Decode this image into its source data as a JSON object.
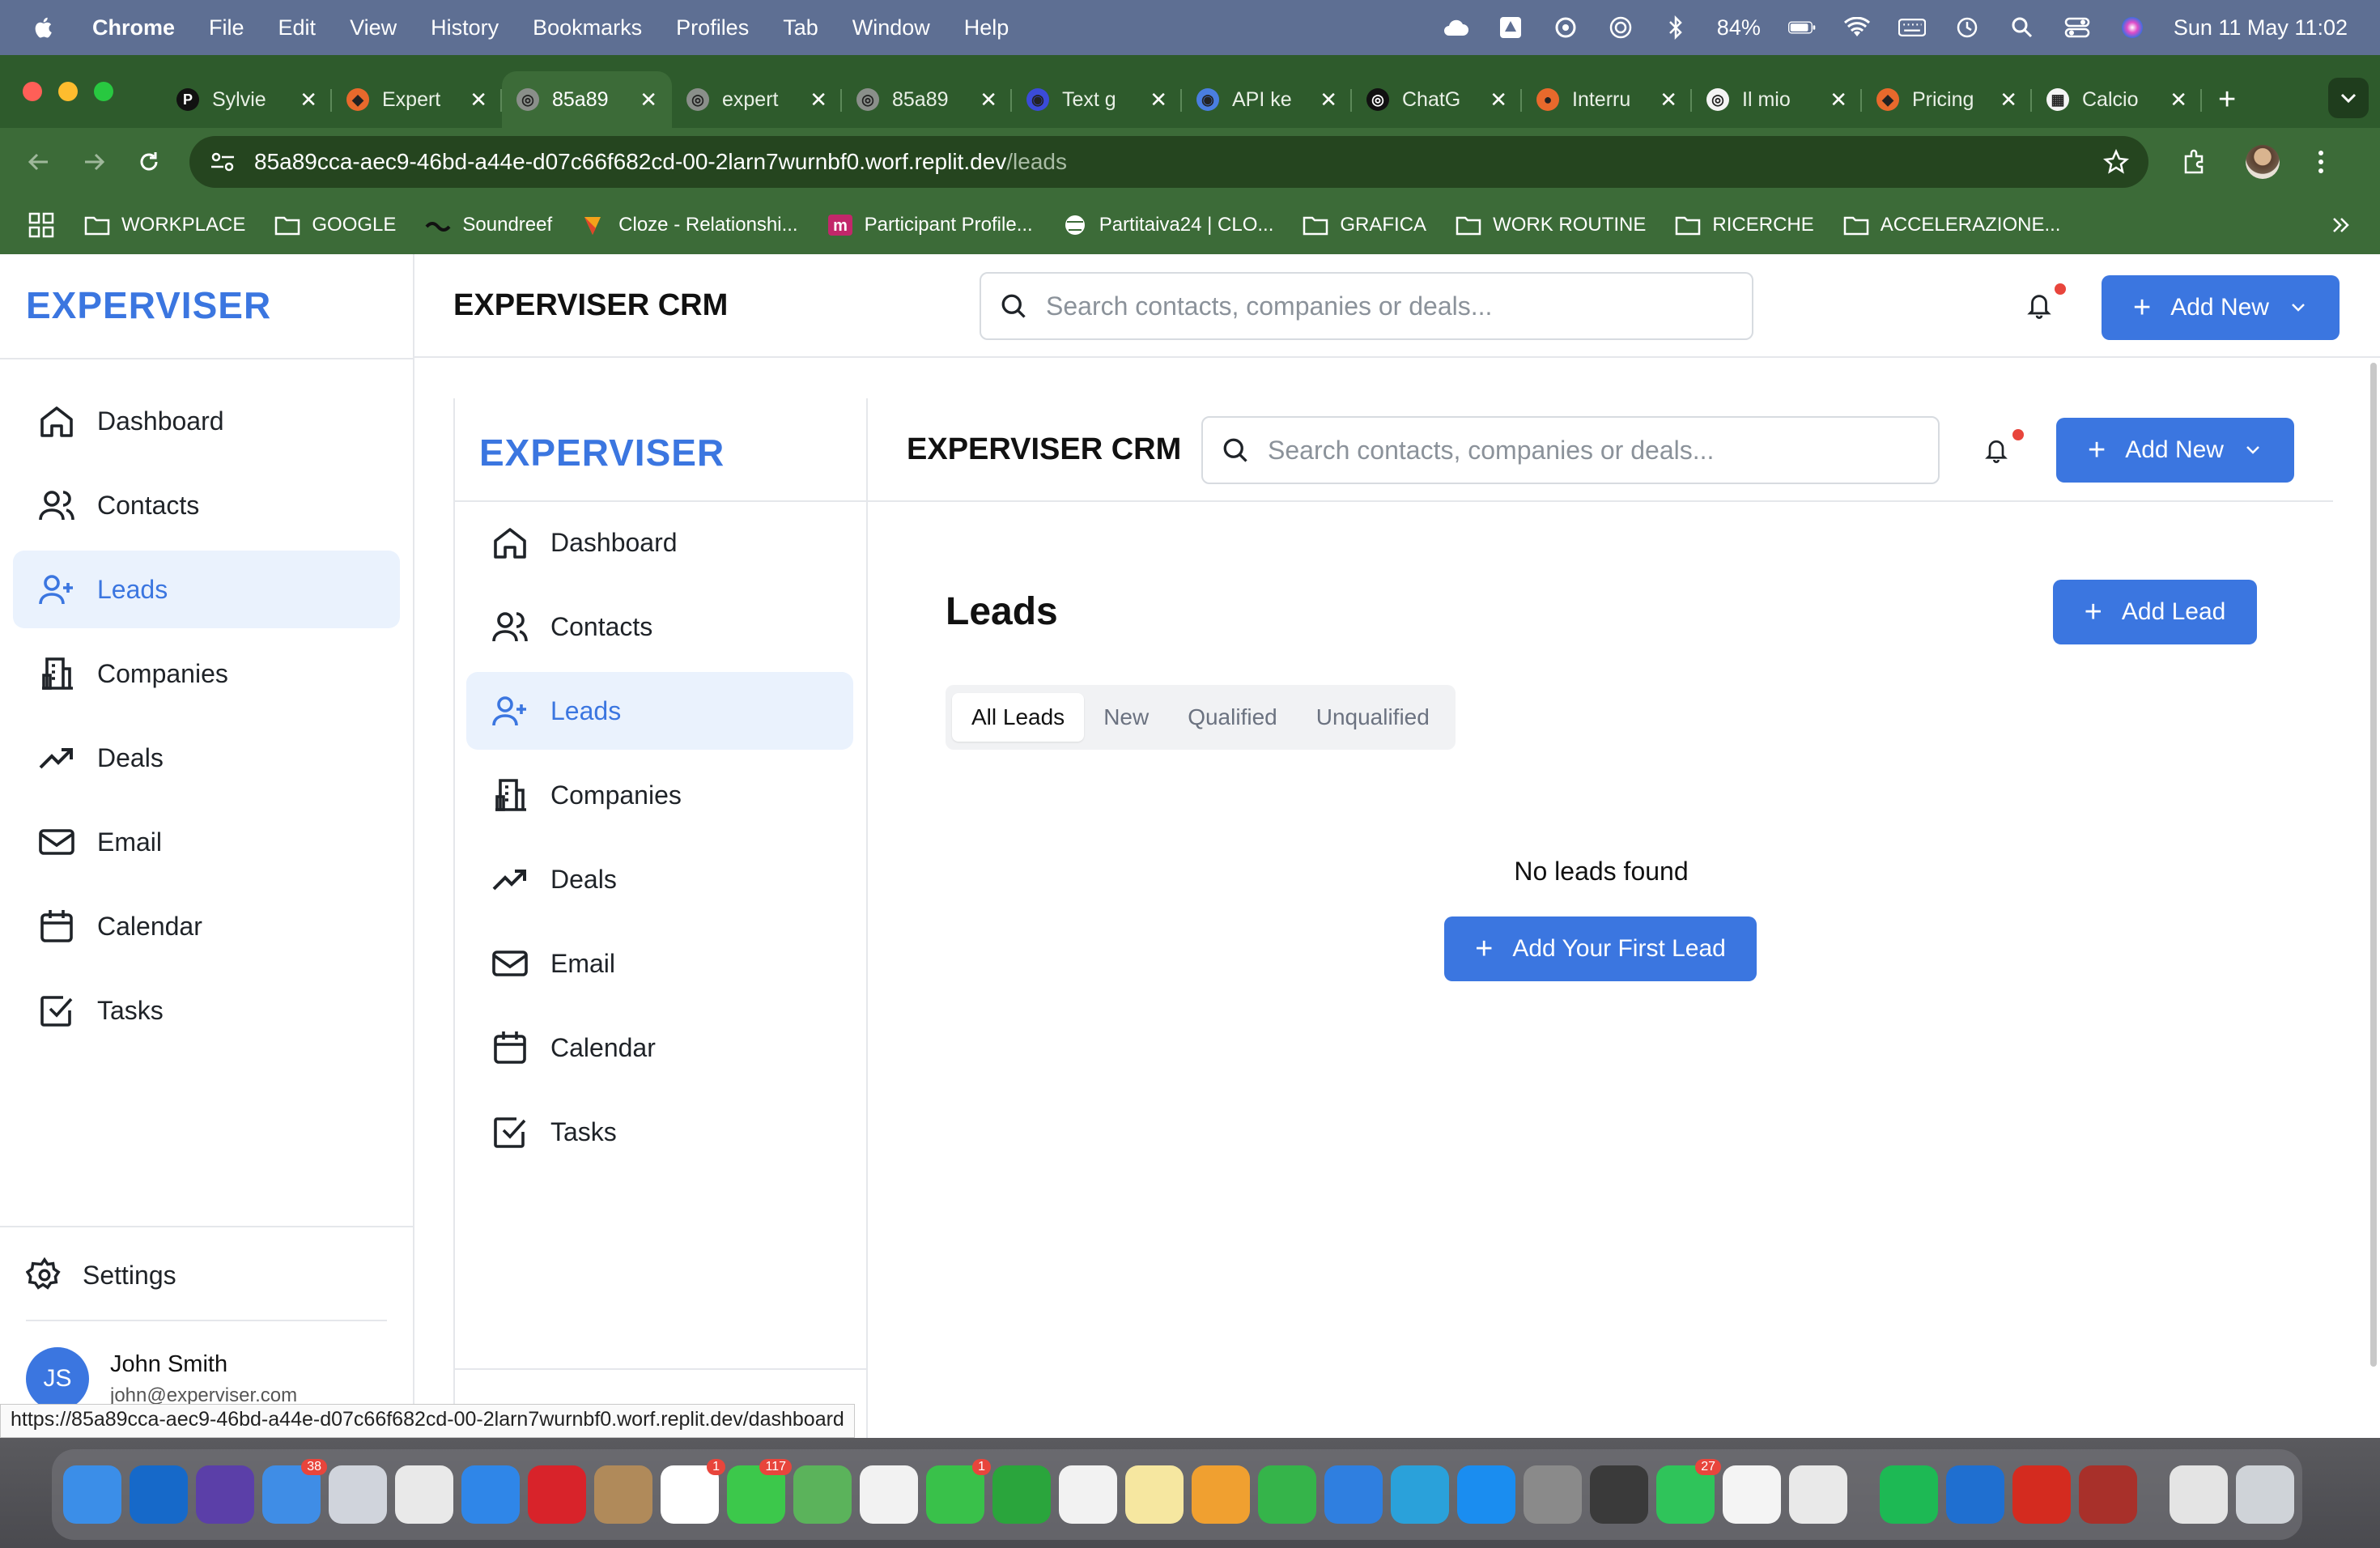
{
  "menubar": {
    "app": "Chrome",
    "items": [
      "File",
      "Edit",
      "View",
      "History",
      "Bookmarks",
      "Profiles",
      "Tab",
      "Window",
      "Help"
    ],
    "battery": "84%",
    "datetime": "Sun 11 May  11:02"
  },
  "tabs": [
    {
      "title": "Sylvie",
      "fav": "P",
      "favcolor": "#111111",
      "active": false
    },
    {
      "title": "Expert",
      "fav": "◆",
      "favcolor": "#e8692c",
      "active": false
    },
    {
      "title": "85a89",
      "fav": "◎",
      "favcolor": "#8a8f8a",
      "active": true
    },
    {
      "title": "expert",
      "fav": "◎",
      "favcolor": "#8a8f8a",
      "active": false
    },
    {
      "title": "85a89",
      "fav": "◎",
      "favcolor": "#8a8f8a",
      "active": false
    },
    {
      "title": "Text g",
      "fav": "◉",
      "favcolor": "#3b4bd8",
      "active": false
    },
    {
      "title": "API ke",
      "fav": "◉",
      "favcolor": "#4a7ee0",
      "active": false
    },
    {
      "title": "ChatG",
      "fav": "◎",
      "favcolor": "#111111",
      "active": false
    },
    {
      "title": "Interru",
      "fav": "●",
      "favcolor": "#e8692c",
      "active": false
    },
    {
      "title": "Il mio",
      "fav": "◎",
      "favcolor": "#f4f4f4",
      "active": false
    },
    {
      "title": "Pricing",
      "fav": "◆",
      "favcolor": "#e8692c",
      "active": false
    },
    {
      "title": "Calcio",
      "fav": "▦",
      "favcolor": "#f4f4f4",
      "active": false
    }
  ],
  "address": {
    "host": "85a89cca-aec9-46bd-a44e-d07c66f682cd-00-2larn7wurnbf0.worf.replit.dev",
    "path": "/leads"
  },
  "bookmarks": [
    "WORKPLACE",
    "GOOGLE",
    "Soundreef",
    "Cloze - Relationshi...",
    "Participant Profile...",
    "Partitaiva24 | CLO...",
    "GRAFICA",
    "WORK ROUTINE",
    "RICERCHE",
    "ACCELERAZIONE..."
  ],
  "app": {
    "logo": "EXPERVISER",
    "crm_title": "EXPERVISER CRM",
    "search_placeholder": "Search contacts, companies or deals...",
    "add_new": "Add New",
    "nav": [
      {
        "label": "Dashboard",
        "icon": "home-icon"
      },
      {
        "label": "Contacts",
        "icon": "users-icon"
      },
      {
        "label": "Leads",
        "icon": "user-plus-icon"
      },
      {
        "label": "Companies",
        "icon": "building-icon"
      },
      {
        "label": "Deals",
        "icon": "trending-up-icon"
      },
      {
        "label": "Email",
        "icon": "mail-icon"
      },
      {
        "label": "Calendar",
        "icon": "calendar-icon"
      },
      {
        "label": "Tasks",
        "icon": "check-square-icon"
      }
    ],
    "active_nav": "Leads",
    "settings": "Settings",
    "user": {
      "initials": "JS",
      "name": "John Smith",
      "email": "john@experviser.com"
    },
    "page_title": "Leads",
    "add_lead": "Add Lead",
    "filters": [
      "All Leads",
      "New",
      "Qualified",
      "Unqualified"
    ],
    "active_filter": "All Leads",
    "empty_text": "No leads found",
    "add_first": "Add Your First Lead"
  },
  "status_url": "https://85a89cca-aec9-46bd-a44e-d07c66f682cd-00-2larn7wurnbf0.worf.replit.dev/dashboard",
  "dock": {
    "apps": [
      {
        "name": "Finder",
        "color": "#3b8ee8"
      },
      {
        "name": "Outlook",
        "color": "#1669c9"
      },
      {
        "name": "Siri",
        "color": "#5b3fa8"
      },
      {
        "name": "Mail",
        "color": "#3f8de6",
        "badge": "38"
      },
      {
        "name": "Launchpad",
        "color": "#d0d4dc"
      },
      {
        "name": "Chrome",
        "color": "#e9e9e9"
      },
      {
        "name": "Safari",
        "color": "#2f86e8"
      },
      {
        "name": "Opera",
        "color": "#d8232a"
      },
      {
        "name": "Contacts",
        "color": "#b08a5a"
      },
      {
        "name": "Calendar",
        "color": "#ffffff",
        "badge": "1"
      },
      {
        "name": "Messages",
        "color": "#3cc84b",
        "badge": "117"
      },
      {
        "name": "Maps",
        "color": "#5bb35b"
      },
      {
        "name": "Photos",
        "color": "#f2f2f2"
      },
      {
        "name": "FaceTime",
        "color": "#39c14a",
        "badge": "1"
      },
      {
        "name": "Chat",
        "color": "#2aa53c"
      },
      {
        "name": "Evernote",
        "color": "#f2f2f2"
      },
      {
        "name": "Notes",
        "color": "#f6e7a0"
      },
      {
        "name": "Pages",
        "color": "#f0a030"
      },
      {
        "name": "Numbers",
        "color": "#35b44a"
      },
      {
        "name": "Keynote",
        "color": "#2f7fe0"
      },
      {
        "name": "Telegram",
        "color": "#2aa1da"
      },
      {
        "name": "App Store",
        "color": "#1a8df0"
      },
      {
        "name": "System Settings",
        "color": "#8a8a8a"
      },
      {
        "name": "Phone",
        "color": "#3a3a3a"
      },
      {
        "name": "WhatsApp",
        "color": "#2fc45a",
        "badge": "27"
      },
      {
        "name": "ChatGPT",
        "color": "#f4f4f4"
      },
      {
        "name": "Mirror",
        "color": "#e9e9e9"
      },
      {
        "name": "Spotify",
        "color": "#1db954"
      },
      {
        "name": "Trello",
        "color": "#1f6fd0"
      },
      {
        "name": "Acrobat",
        "color": "#d42b1f"
      },
      {
        "name": "Dictionary",
        "color": "#a8302a"
      },
      {
        "name": "Preview",
        "color": "#e4e4e4"
      },
      {
        "name": "Trash",
        "color": "#cfd3d8"
      }
    ]
  }
}
